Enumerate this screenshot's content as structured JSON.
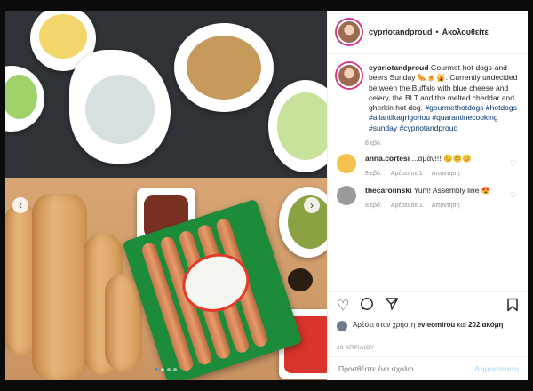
{
  "header": {
    "username": "cypriotandproud",
    "separator": "•",
    "follow_label": "Ακολουθείτε"
  },
  "caption": {
    "username": "cypriotandproud",
    "text": "Gourmet-hot-dogs-and-beers Sunday 🌭🍺🙀. Currently undecided between the Buffalo with blue cheese and celery, the BLT and the melted cheddar and gherkin hot dog.",
    "hashtags": [
      "#gourmethotdogs",
      "#hotdogs",
      "#allantikagrigoriou",
      "#quarantinecooking",
      "#sunday",
      "#cypriotandproud"
    ],
    "time": "8 εβδ."
  },
  "comments": [
    {
      "username": "anna.cortesi",
      "text": "...αμάν!!! 😊😊😊",
      "time": "8 εβδ.",
      "likes": "Αρέσει σε 1",
      "reply": "Απάντηση",
      "avatar_color": "#f2c14e"
    },
    {
      "username": "thecarolinski",
      "text": "Yum! Assembly line 😍",
      "time": "8 εβδ.",
      "likes": "Αρέσει σε 1",
      "reply": "Απάντηση",
      "avatar_color": "#9a9a9a"
    }
  ],
  "actions": {
    "like_icon": "heart-icon",
    "comment_icon": "comment-icon",
    "share_icon": "paper-plane-icon",
    "save_icon": "bookmark-icon"
  },
  "likes": {
    "prefix": "Αρέσει στον χρήστη",
    "user": "evieomirou",
    "connector": "και",
    "count": "202 ακόμη"
  },
  "date": "28 ΑΠΡΙΛΙΟΥ",
  "composer": {
    "placeholder": "Προσθέστε ένα σχόλιο...",
    "post_label": "Δημοσίευση"
  },
  "carousel": {
    "prev": "‹",
    "next": "›",
    "slides": 4,
    "active": 1
  }
}
